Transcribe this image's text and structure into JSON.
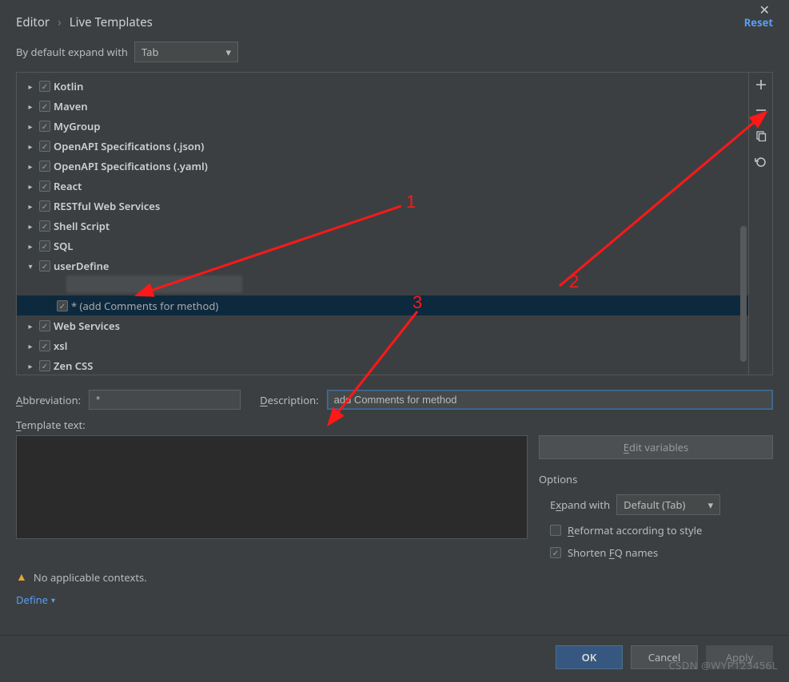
{
  "breadcrumb": {
    "parent": "Editor",
    "sep": "›",
    "current": "Live Templates"
  },
  "reset_label": "Reset",
  "expand": {
    "label": "By default expand with",
    "value": "Tab"
  },
  "tree": {
    "groups": [
      {
        "label": "Kotlin",
        "checked": true,
        "expanded": false
      },
      {
        "label": "Maven",
        "checked": true,
        "expanded": false
      },
      {
        "label": "MyGroup",
        "checked": true,
        "expanded": false
      },
      {
        "label": "OpenAPI Specifications (.json)",
        "checked": true,
        "expanded": false
      },
      {
        "label": "OpenAPI Specifications (.yaml)",
        "checked": true,
        "expanded": false
      },
      {
        "label": "React",
        "checked": true,
        "expanded": false
      },
      {
        "label": "RESTful Web Services",
        "checked": true,
        "expanded": false
      },
      {
        "label": "Shell Script",
        "checked": true,
        "expanded": false
      },
      {
        "label": "SQL",
        "checked": true,
        "expanded": false
      },
      {
        "label": "userDefine",
        "checked": true,
        "expanded": true,
        "children": [
          {
            "label": "",
            "checked": true,
            "obscured": true
          },
          {
            "label": "* (add Comments for method)",
            "checked": true,
            "selected": true
          }
        ]
      },
      {
        "label": "Web Services",
        "checked": true,
        "expanded": false
      },
      {
        "label": "xsl",
        "checked": true,
        "expanded": false
      },
      {
        "label": "Zen CSS",
        "checked": true,
        "expanded": false
      }
    ]
  },
  "toolbar": {
    "add_tip": "Add",
    "remove_tip": "Remove",
    "copy_tip": "Duplicate",
    "revert_tip": "Revert"
  },
  "form": {
    "abbrev_label": "Abbreviation:",
    "abbrev_value": "*",
    "desc_label": "Description:",
    "desc_value": "add Comments for method",
    "template_label": "Template text:",
    "template_value": "",
    "edit_vars": "Edit variables",
    "options_title": "Options",
    "expand_with_label": "Expand with",
    "expand_with_value": "Default (Tab)",
    "reformat_label": "Reformat according to style",
    "reformat_checked": false,
    "shorten_label": "Shorten FQ names",
    "shorten_checked": true
  },
  "context": {
    "warn_text": "No applicable contexts.",
    "define_label": "Define"
  },
  "footer": {
    "ok": "OK",
    "cancel": "Cancel",
    "apply": "Apply"
  },
  "annotations": {
    "n1": "1",
    "n2": "2",
    "n3": "3"
  },
  "watermark": "CSDN @WYP123456L"
}
